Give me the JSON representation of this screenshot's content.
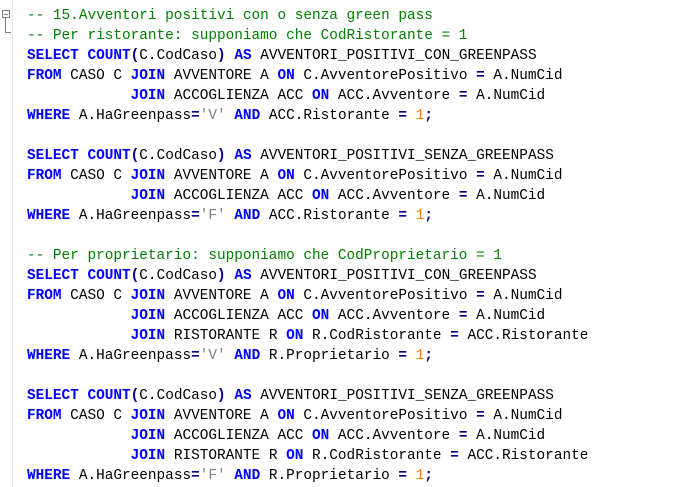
{
  "editor": {
    "lines": [
      [
        {
          "t": "cm",
          "v": "-- 15.Avventori positivi con o senza green pass"
        }
      ],
      [
        {
          "t": "cm",
          "v": "-- Per ristorante: supponiamo che CodRistorante = 1"
        }
      ],
      [
        {
          "t": "kw",
          "v": "SELECT"
        },
        {
          "t": "id",
          "v": " "
        },
        {
          "t": "kw",
          "v": "COUNT"
        },
        {
          "t": "op",
          "v": "("
        },
        {
          "t": "id",
          "v": "C.CodCaso"
        },
        {
          "t": "op",
          "v": ")"
        },
        {
          "t": "id",
          "v": " "
        },
        {
          "t": "kw",
          "v": "AS"
        },
        {
          "t": "id",
          "v": " AVVENTORI_POSITIVI_CON_GREENPASS"
        }
      ],
      [
        {
          "t": "kw",
          "v": "FROM"
        },
        {
          "t": "id",
          "v": " CASO C "
        },
        {
          "t": "kw",
          "v": "JOIN"
        },
        {
          "t": "id",
          "v": " AVVENTORE A "
        },
        {
          "t": "kw",
          "v": "ON"
        },
        {
          "t": "id",
          "v": " C.AvventorePositivo "
        },
        {
          "t": "op",
          "v": "="
        },
        {
          "t": "id",
          "v": " A.NumCid"
        }
      ],
      [
        {
          "t": "id",
          "v": "            "
        },
        {
          "t": "kw",
          "v": "JOIN"
        },
        {
          "t": "id",
          "v": " ACCOGLIENZA ACC "
        },
        {
          "t": "kw",
          "v": "ON"
        },
        {
          "t": "id",
          "v": " ACC.Avventore "
        },
        {
          "t": "op",
          "v": "="
        },
        {
          "t": "id",
          "v": " A.NumCid"
        }
      ],
      [
        {
          "t": "kw",
          "v": "WHERE"
        },
        {
          "t": "id",
          "v": " A.HaGreenpass"
        },
        {
          "t": "op",
          "v": "="
        },
        {
          "t": "st",
          "v": "'V'"
        },
        {
          "t": "id",
          "v": " "
        },
        {
          "t": "kw",
          "v": "AND"
        },
        {
          "t": "id",
          "v": " ACC.Ristorante "
        },
        {
          "t": "op",
          "v": "="
        },
        {
          "t": "id",
          "v": " "
        },
        {
          "t": "nm",
          "v": "1"
        },
        {
          "t": "op",
          "v": ";"
        }
      ],
      [],
      [
        {
          "t": "kw",
          "v": "SELECT"
        },
        {
          "t": "id",
          "v": " "
        },
        {
          "t": "kw",
          "v": "COUNT"
        },
        {
          "t": "op",
          "v": "("
        },
        {
          "t": "id",
          "v": "C.CodCaso"
        },
        {
          "t": "op",
          "v": ")"
        },
        {
          "t": "id",
          "v": " "
        },
        {
          "t": "kw",
          "v": "AS"
        },
        {
          "t": "id",
          "v": " AVVENTORI_POSITIVI_SENZA_GREENPASS"
        }
      ],
      [
        {
          "t": "kw",
          "v": "FROM"
        },
        {
          "t": "id",
          "v": " CASO C "
        },
        {
          "t": "kw",
          "v": "JOIN"
        },
        {
          "t": "id",
          "v": " AVVENTORE A "
        },
        {
          "t": "kw",
          "v": "ON"
        },
        {
          "t": "id",
          "v": " C.AvventorePositivo "
        },
        {
          "t": "op",
          "v": "="
        },
        {
          "t": "id",
          "v": " A.NumCid"
        }
      ],
      [
        {
          "t": "id",
          "v": "            "
        },
        {
          "t": "kw",
          "v": "JOIN"
        },
        {
          "t": "id",
          "v": " ACCOGLIENZA ACC "
        },
        {
          "t": "kw",
          "v": "ON"
        },
        {
          "t": "id",
          "v": " ACC.Avventore "
        },
        {
          "t": "op",
          "v": "="
        },
        {
          "t": "id",
          "v": " A.NumCid"
        }
      ],
      [
        {
          "t": "kw",
          "v": "WHERE"
        },
        {
          "t": "id",
          "v": " A.HaGreenpass"
        },
        {
          "t": "op",
          "v": "="
        },
        {
          "t": "st",
          "v": "'F'"
        },
        {
          "t": "id",
          "v": " "
        },
        {
          "t": "kw",
          "v": "AND"
        },
        {
          "t": "id",
          "v": " ACC.Ristorante "
        },
        {
          "t": "op",
          "v": "="
        },
        {
          "t": "id",
          "v": " "
        },
        {
          "t": "nm",
          "v": "1"
        },
        {
          "t": "op",
          "v": ";"
        }
      ],
      [],
      [
        {
          "t": "cm",
          "v": "-- Per proprietario: supponiamo che CodProprietario = 1"
        }
      ],
      [
        {
          "t": "kw",
          "v": "SELECT"
        },
        {
          "t": "id",
          "v": " "
        },
        {
          "t": "kw",
          "v": "COUNT"
        },
        {
          "t": "op",
          "v": "("
        },
        {
          "t": "id",
          "v": "C.CodCaso"
        },
        {
          "t": "op",
          "v": ")"
        },
        {
          "t": "id",
          "v": " "
        },
        {
          "t": "kw",
          "v": "AS"
        },
        {
          "t": "id",
          "v": " AVVENTORI_POSITIVI_CON_GREENPASS"
        }
      ],
      [
        {
          "t": "kw",
          "v": "FROM"
        },
        {
          "t": "id",
          "v": " CASO C "
        },
        {
          "t": "kw",
          "v": "JOIN"
        },
        {
          "t": "id",
          "v": " AVVENTORE A "
        },
        {
          "t": "kw",
          "v": "ON"
        },
        {
          "t": "id",
          "v": " C.AvventorePositivo "
        },
        {
          "t": "op",
          "v": "="
        },
        {
          "t": "id",
          "v": " A.NumCid"
        }
      ],
      [
        {
          "t": "id",
          "v": "            "
        },
        {
          "t": "kw",
          "v": "JOIN"
        },
        {
          "t": "id",
          "v": " ACCOGLIENZA ACC "
        },
        {
          "t": "kw",
          "v": "ON"
        },
        {
          "t": "id",
          "v": " ACC.Avventore "
        },
        {
          "t": "op",
          "v": "="
        },
        {
          "t": "id",
          "v": " A.NumCid"
        }
      ],
      [
        {
          "t": "id",
          "v": "            "
        },
        {
          "t": "kw",
          "v": "JOIN"
        },
        {
          "t": "id",
          "v": " RISTORANTE R "
        },
        {
          "t": "kw",
          "v": "ON"
        },
        {
          "t": "id",
          "v": " R.CodRistorante "
        },
        {
          "t": "op",
          "v": "="
        },
        {
          "t": "id",
          "v": " ACC.Ristorante"
        }
      ],
      [
        {
          "t": "kw",
          "v": "WHERE"
        },
        {
          "t": "id",
          "v": " A.HaGreenpass"
        },
        {
          "t": "op",
          "v": "="
        },
        {
          "t": "st",
          "v": "'V'"
        },
        {
          "t": "id",
          "v": " "
        },
        {
          "t": "kw",
          "v": "AND"
        },
        {
          "t": "id",
          "v": " R.Proprietario "
        },
        {
          "t": "op",
          "v": "="
        },
        {
          "t": "id",
          "v": " "
        },
        {
          "t": "nm",
          "v": "1"
        },
        {
          "t": "op",
          "v": ";"
        }
      ],
      [],
      [
        {
          "t": "kw",
          "v": "SELECT"
        },
        {
          "t": "id",
          "v": " "
        },
        {
          "t": "kw",
          "v": "COUNT"
        },
        {
          "t": "op",
          "v": "("
        },
        {
          "t": "id",
          "v": "C.CodCaso"
        },
        {
          "t": "op",
          "v": ")"
        },
        {
          "t": "id",
          "v": " "
        },
        {
          "t": "kw",
          "v": "AS"
        },
        {
          "t": "id",
          "v": " AVVENTORI_POSITIVI_SENZA_GREENPASS"
        }
      ],
      [
        {
          "t": "kw",
          "v": "FROM"
        },
        {
          "t": "id",
          "v": " CASO C "
        },
        {
          "t": "kw",
          "v": "JOIN"
        },
        {
          "t": "id",
          "v": " AVVENTORE A "
        },
        {
          "t": "kw",
          "v": "ON"
        },
        {
          "t": "id",
          "v": " C.AvventorePositivo "
        },
        {
          "t": "op",
          "v": "="
        },
        {
          "t": "id",
          "v": " A.NumCid"
        }
      ],
      [
        {
          "t": "id",
          "v": "            "
        },
        {
          "t": "kw",
          "v": "JOIN"
        },
        {
          "t": "id",
          "v": " ACCOGLIENZA ACC "
        },
        {
          "t": "kw",
          "v": "ON"
        },
        {
          "t": "id",
          "v": " ACC.Avventore "
        },
        {
          "t": "op",
          "v": "="
        },
        {
          "t": "id",
          "v": " A.NumCid"
        }
      ],
      [
        {
          "t": "id",
          "v": "            "
        },
        {
          "t": "kw",
          "v": "JOIN"
        },
        {
          "t": "id",
          "v": " RISTORANTE R "
        },
        {
          "t": "kw",
          "v": "ON"
        },
        {
          "t": "id",
          "v": " R.CodRistorante "
        },
        {
          "t": "op",
          "v": "="
        },
        {
          "t": "id",
          "v": " ACC.Ristorante"
        }
      ],
      [
        {
          "t": "kw",
          "v": "WHERE"
        },
        {
          "t": "id",
          "v": " A.HaGreenpass"
        },
        {
          "t": "op",
          "v": "="
        },
        {
          "t": "st",
          "v": "'F'"
        },
        {
          "t": "id",
          "v": " "
        },
        {
          "t": "kw",
          "v": "AND"
        },
        {
          "t": "id",
          "v": " R.Proprietario "
        },
        {
          "t": "op",
          "v": "="
        },
        {
          "t": "id",
          "v": " "
        },
        {
          "t": "nm",
          "v": "1"
        },
        {
          "t": "op",
          "v": ";"
        }
      ]
    ]
  },
  "colors": {
    "keyword": "#0000ff",
    "comment": "#008000",
    "string": "#808080",
    "number": "#ff8000",
    "operator": "#000080"
  }
}
